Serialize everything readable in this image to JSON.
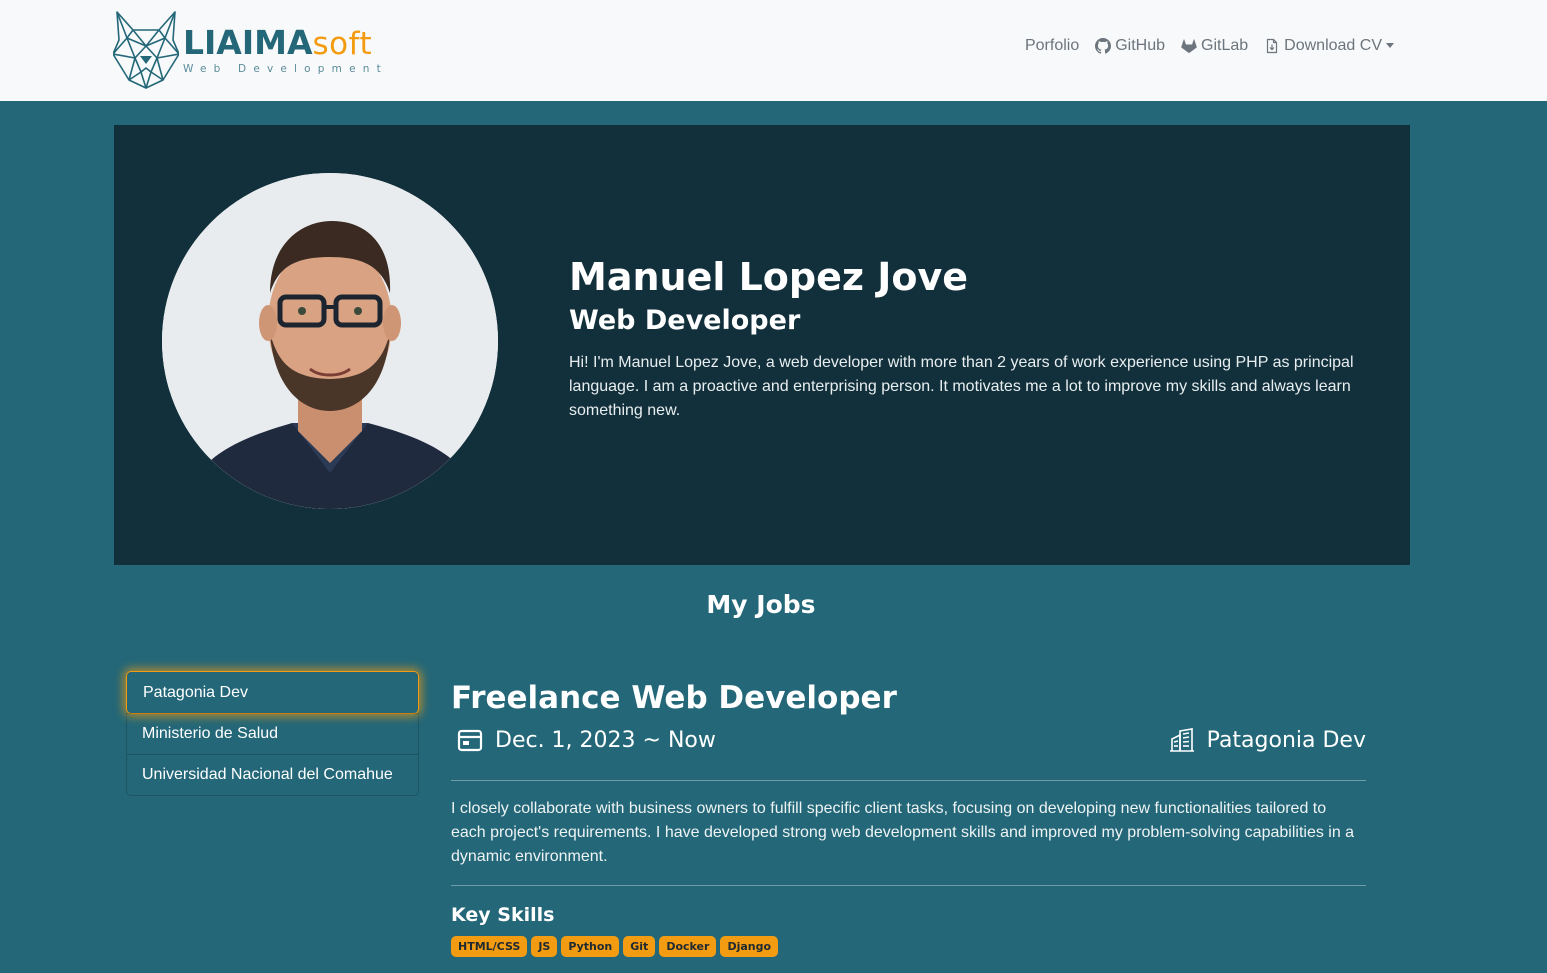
{
  "brand": {
    "name_bold": "LIAIMA",
    "name_light": "soft",
    "tagline": "Web Development",
    "colors": {
      "primary": "#236778",
      "accent": "#f39c12"
    }
  },
  "nav": {
    "items": [
      {
        "label": "Porfolio",
        "icon": ""
      },
      {
        "label": "GitHub",
        "icon": "github-icon"
      },
      {
        "label": "GitLab",
        "icon": "gitlab-icon"
      },
      {
        "label": "Download CV",
        "icon": "file-download-icon",
        "dropdown": true
      }
    ]
  },
  "hero": {
    "name": "Manuel Lopez Jove",
    "role": "Web Developer",
    "bio": "Hi! I'm Manuel Lopez Jove, a web developer with more than 2 years of work experience using PHP as principal language. I am a proactive and enterprising person. It motivates me a lot to improve my skills and always learn something new."
  },
  "jobs": {
    "section_title": "My Jobs",
    "list": [
      {
        "label": "Patagonia Dev",
        "active": true
      },
      {
        "label": "Ministerio de Salud",
        "active": false
      },
      {
        "label": "Universidad Nacional del Comahue",
        "active": false
      }
    ],
    "detail": {
      "title": "Freelance Web Developer",
      "period": "Dec. 1, 2023 ~ Now",
      "company": "Patagonia Dev",
      "description": "I closely collaborate with business owners to fulfill specific client tasks, focusing on developing new functionalities tailored to each project's requirements. I have developed strong web development skills and improved my problem-solving capabilities in a dynamic environment.",
      "skills_title": "Key Skills",
      "skills": [
        "HTML/CSS",
        "JS",
        "Python",
        "Git",
        "Docker",
        "Django"
      ]
    }
  },
  "colors": {
    "page_bg": "#236778",
    "hero_bg": "#12303b",
    "navbar_bg": "#f8f9fa",
    "badge_bg": "#f39c12"
  }
}
